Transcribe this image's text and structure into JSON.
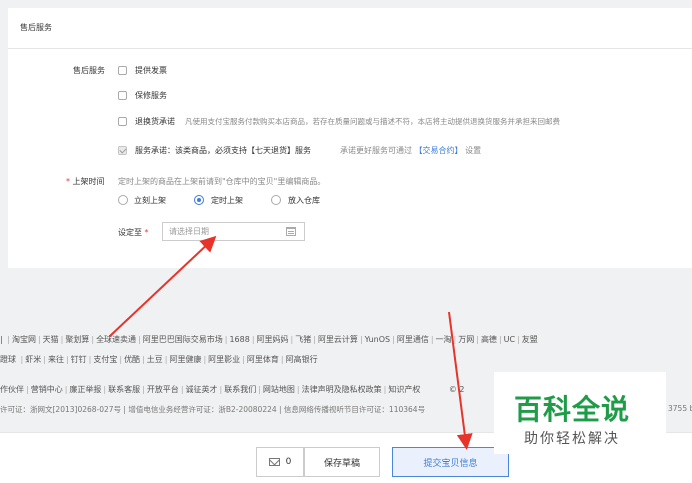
{
  "section": {
    "title": "售后服务"
  },
  "after_sales": {
    "label": "售后服务",
    "options": [
      {
        "label": "提供发票",
        "checked": false
      },
      {
        "label": "保修服务",
        "checked": false
      },
      {
        "label": "退换货承诺",
        "desc": "凡使用支付宝服务付款购买本店商品，若存在质量问题或与描述不符，本店将主动提供退换货服务并承担来回邮费",
        "checked": false
      },
      {
        "label": "服务承诺：该类商品，必须支持【七天退货】服务",
        "checked": true
      }
    ],
    "promise_hint": "承诺更好服务可通过",
    "promise_link": "【交易合约】",
    "promise_tail": "设置"
  },
  "listing": {
    "required_mark": "*",
    "label": "上架时间",
    "hint": "定时上架的商品在上架前请到\"仓库中的宝贝\"里编辑商品。",
    "options": [
      {
        "label": "立刻上架",
        "selected": false
      },
      {
        "label": "定时上架",
        "selected": true
      },
      {
        "label": "放入仓库",
        "selected": false
      }
    ],
    "set_label": "设定至",
    "set_required": "*",
    "date_placeholder": "请选择日期",
    "date_value": ""
  },
  "footer": {
    "row1": [
      "淘宝网",
      "天猫",
      "聚划算",
      "全球速卖通",
      "阿里巴巴国际交易市场",
      "1688",
      "阿里妈妈",
      "飞猪",
      "阿里云计算",
      "YunOS",
      "阿里通信",
      "一淘",
      "万网",
      "高德",
      "UC",
      "友盟"
    ],
    "row1_lead": "|",
    "row2": [
      "虾米",
      "来往",
      "钉钉",
      "支付宝",
      "优酷",
      "土豆",
      "阿里健康",
      "阿里影业",
      "阿里体育",
      "阿高银行"
    ],
    "row2_lead": "蹬球",
    "row3": [
      "作伙伴",
      "营销中心",
      "廉正举报",
      "联系客服",
      "开放平台",
      "诚征英才",
      "联系我们",
      "网站地图",
      "法律声明及隐私权政策",
      "知识产权"
    ],
    "row3_tail": "© 2",
    "license": "许可证：浙网文[2013]0268-027号  |  增值电信业务经营许可证：浙B2-20080224  |  信息网络传播视听节目许可证：110364号",
    "license_tail": "3755 b"
  },
  "actions": {
    "message_count": "0",
    "save_draft": "保存草稿",
    "submit": "提交宝贝信息"
  },
  "watermark": {
    "title": "百科全说",
    "subtitle": "助你轻松解决"
  },
  "colors": {
    "accent": "#3c7bd9",
    "arrow": "#e8332a",
    "required": "#e4393c",
    "watermark": "#1f9c48"
  }
}
